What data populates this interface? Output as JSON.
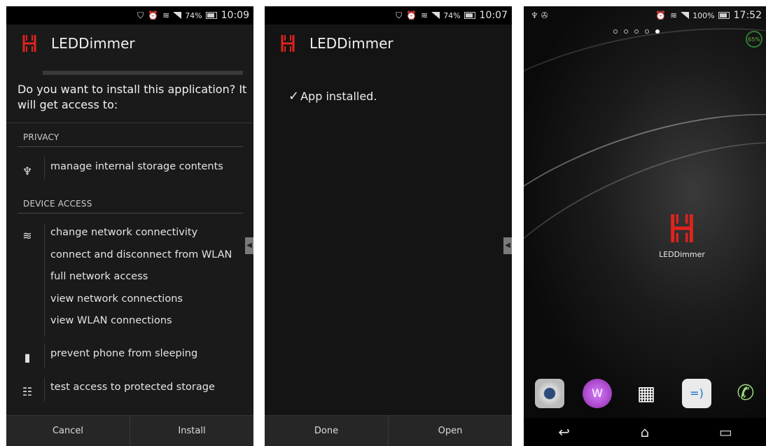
{
  "screens": [
    {
      "status": {
        "battery": "74%",
        "time": "10:09"
      },
      "app_title": "LEDDimmer",
      "question": "Do you want to install this application? It will get access to:",
      "sections": [
        {
          "title": "PRIVACY"
        },
        {
          "title": "DEVICE ACCESS"
        }
      ],
      "permissions": {
        "storage": "manage internal storage contents",
        "network": [
          "change network connectivity",
          "connect and disconnect from WLAN",
          "full network access",
          "view network connections",
          "view WLAN connections"
        ],
        "sleep": "prevent phone from sleeping",
        "protected": "test access to protected storage"
      },
      "buttons": {
        "left": "Cancel",
        "right": "Install"
      }
    },
    {
      "status": {
        "battery": "74%",
        "time": "10:07"
      },
      "app_title": "LEDDimmer",
      "message": "App installed.",
      "buttons": {
        "left": "Done",
        "right": "Open"
      }
    },
    {
      "status": {
        "battery": "100%",
        "time": "17:52"
      },
      "battery_widget": "65%",
      "page_dots": 5,
      "active_dot": 4,
      "home_app_label": "LEDDimmer",
      "dock": [
        "camera-icon",
        "walkman-icon",
        "app-drawer-icon",
        "messaging-icon",
        "phone-icon"
      ],
      "nav": [
        "back-icon",
        "home-icon",
        "recent-apps-icon"
      ]
    }
  ],
  "colors": {
    "accent_red": "#e0231e",
    "panel_dark": "#1a1a1a",
    "bottom_bar": "#262626"
  }
}
